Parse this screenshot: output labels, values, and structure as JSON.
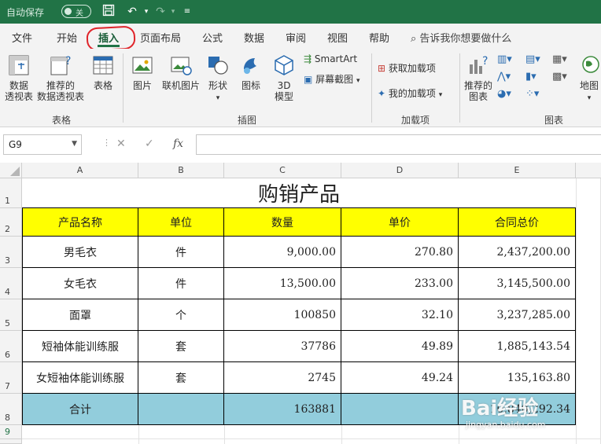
{
  "titlebar": {
    "autosave_label": "自动保存",
    "autosave_state": "关"
  },
  "tabs": [
    {
      "label": "文件"
    },
    {
      "label": "开始"
    },
    {
      "label": "插入"
    },
    {
      "label": "页面布局"
    },
    {
      "label": "公式"
    },
    {
      "label": "数据"
    },
    {
      "label": "审阅"
    },
    {
      "label": "视图"
    },
    {
      "label": "帮助"
    }
  ],
  "tell_me": "告诉我你想要做什么",
  "ribbon": {
    "groups": {
      "tables": "表格",
      "illustrations": "插图",
      "addins": "加载项",
      "charts": "图表"
    },
    "pivot_table": [
      "数据",
      "透视表"
    ],
    "recommended_pivot": [
      "推荐的",
      "数据透视表"
    ],
    "table": "表格",
    "picture": "图片",
    "online_picture": "联机图片",
    "shapes": "形状",
    "icons": "图标",
    "model_3d": [
      "3D",
      "模型"
    ],
    "smartart": "SmartArt",
    "screenshot": "屏幕截图",
    "get_addins": "获取加载项",
    "my_addins": "我的加载项",
    "recommended_charts": [
      "推荐的",
      "图表"
    ],
    "map": "地图"
  },
  "formula_bar": {
    "name_box": "G9",
    "fx": "fx",
    "value": ""
  },
  "columns": [
    "A",
    "B",
    "C",
    "D",
    "E"
  ],
  "rows": [
    "1",
    "2",
    "3",
    "4",
    "5",
    "6",
    "7",
    "8",
    "9"
  ],
  "sheet": {
    "title": "购销产品",
    "headers": [
      "产品名称",
      "单位",
      "数量",
      "单价",
      "合同总价"
    ],
    "data": [
      [
        "男毛衣",
        "件",
        "9,000.00",
        "270.80",
        "2,437,200.00"
      ],
      [
        "女毛衣",
        "件",
        "13,500.00",
        "233.00",
        "3,145,500.00"
      ],
      [
        "面罩",
        "个",
        "100850",
        "32.10",
        "3,237,285.00"
      ],
      [
        "短袖体能训练服",
        "套",
        "37786",
        "49.89",
        "1,885,143.54"
      ],
      [
        "女短袖体能训练服",
        "套",
        "2745",
        "49.24",
        "135,163.80"
      ]
    ],
    "total": [
      "合计",
      "",
      "163881",
      "",
      "10,840,292.34"
    ]
  },
  "watermark": {
    "brand": "Bai经验",
    "url": "jingyan.baidu.com"
  },
  "colors": {
    "excel_green": "#217346",
    "header_yellow": "#ffff00",
    "total_blue": "#92cddc",
    "annotation_red": "#e0242a"
  }
}
